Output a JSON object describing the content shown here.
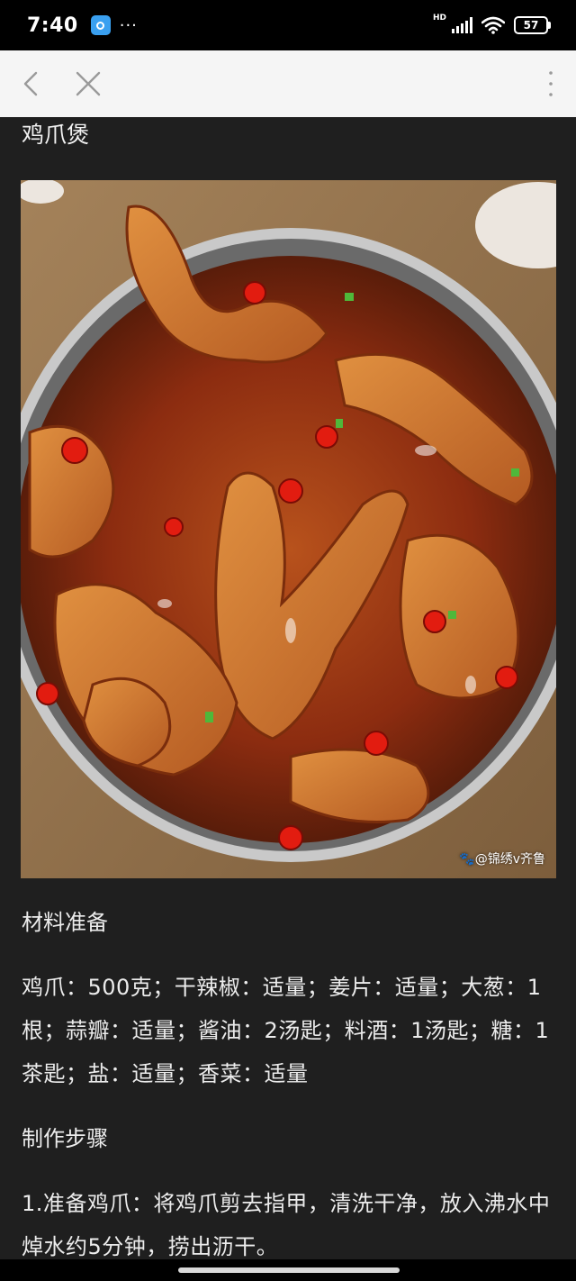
{
  "status_bar": {
    "time": "7:40",
    "app_icon": "browser-icon",
    "more": "···",
    "hd": "HD",
    "battery": "57"
  },
  "nav": {
    "back_icon": "chevron-left-icon",
    "close_icon": "close-icon",
    "menu_icon": "more-vertical-icon"
  },
  "article": {
    "title": "鸡爪煲",
    "photo_watermark": "🐾@锦绣v齐鲁",
    "ingredients_heading": "材料准备",
    "ingredients_text": "鸡爪：500克；干辣椒：适量；姜片：适量；大葱：1根；蒜瓣：适量；酱油：2汤匙；料酒：1汤匙；糖：1茶匙；盐：适量；香菜：适量",
    "steps_heading": "制作步骤",
    "step_1": "1.准备鸡爪：将鸡爪剪去指甲，清洗干净，放入沸水中焯水约5分钟，捞出沥干。"
  },
  "colors": {
    "status_bg": "#000000",
    "nav_bg": "#f5f5f5",
    "page_bg": "#1f1f1f",
    "text": "#ececec"
  }
}
